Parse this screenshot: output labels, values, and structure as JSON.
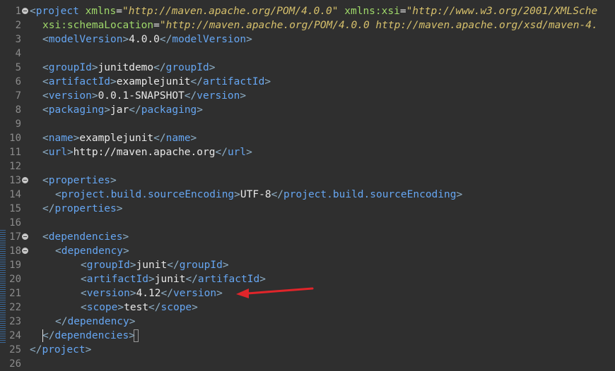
{
  "editor": {
    "line_numbers": [
      "1",
      "2",
      "3",
      "4",
      "5",
      "6",
      "7",
      "8",
      "9",
      "10",
      "11",
      "12",
      "13",
      "14",
      "15",
      "16",
      "17",
      "18",
      "19",
      "20",
      "21",
      "22",
      "23",
      "24",
      "25",
      "26"
    ],
    "colors": {
      "background": "#2f2f2f",
      "tag": "#66a6f2",
      "attribute": "#9fd86a",
      "attribute_value": "#d7c16c",
      "text": "#e8e8e8",
      "annotation_arrow": "#e0252a"
    },
    "lines": {
      "l1": {
        "lt": "<",
        "tag": "project",
        "a1": "xmlns",
        "v1": "\"http://maven.apache.org/POM/4.0.0\"",
        "a2": "xmlns:xsi",
        "v2": "\"http://www.w3.org/2001/XMLSche"
      },
      "l2": {
        "a": "xsi:schemaLocation",
        "v": "\"http://maven.apache.org/POM/4.0.0 http://maven.apache.org/xsd/maven-4."
      },
      "l3": {
        "tag": "modelVersion",
        "text": "4.0.0"
      },
      "l5": {
        "tag": "groupId",
        "text": "junitdemo"
      },
      "l6": {
        "tag": "artifactId",
        "text": "examplejunit"
      },
      "l7": {
        "tag": "version",
        "text": "0.0.1-SNAPSHOT"
      },
      "l8": {
        "tag": "packaging",
        "text": "jar"
      },
      "l10": {
        "tag": "name",
        "text": "examplejunit"
      },
      "l11": {
        "tag": "url",
        "text": "http://maven.apache.org"
      },
      "l13": {
        "tag": "properties"
      },
      "l14": {
        "tag": "project.build.sourceEncoding",
        "text": "UTF-8"
      },
      "l15": {
        "tag": "properties"
      },
      "l17": {
        "tag": "dependencies"
      },
      "l18": {
        "tag": "dependency"
      },
      "l19": {
        "tag": "groupId",
        "text": "junit"
      },
      "l20": {
        "tag": "artifactId",
        "text": "junit"
      },
      "l21": {
        "tag": "version",
        "text": "4.12"
      },
      "l22": {
        "tag": "scope",
        "text": "test"
      },
      "l23": {
        "tag": "dependency"
      },
      "l24": {
        "tag": "dependencies"
      },
      "l25": {
        "tag": "project"
      }
    }
  }
}
